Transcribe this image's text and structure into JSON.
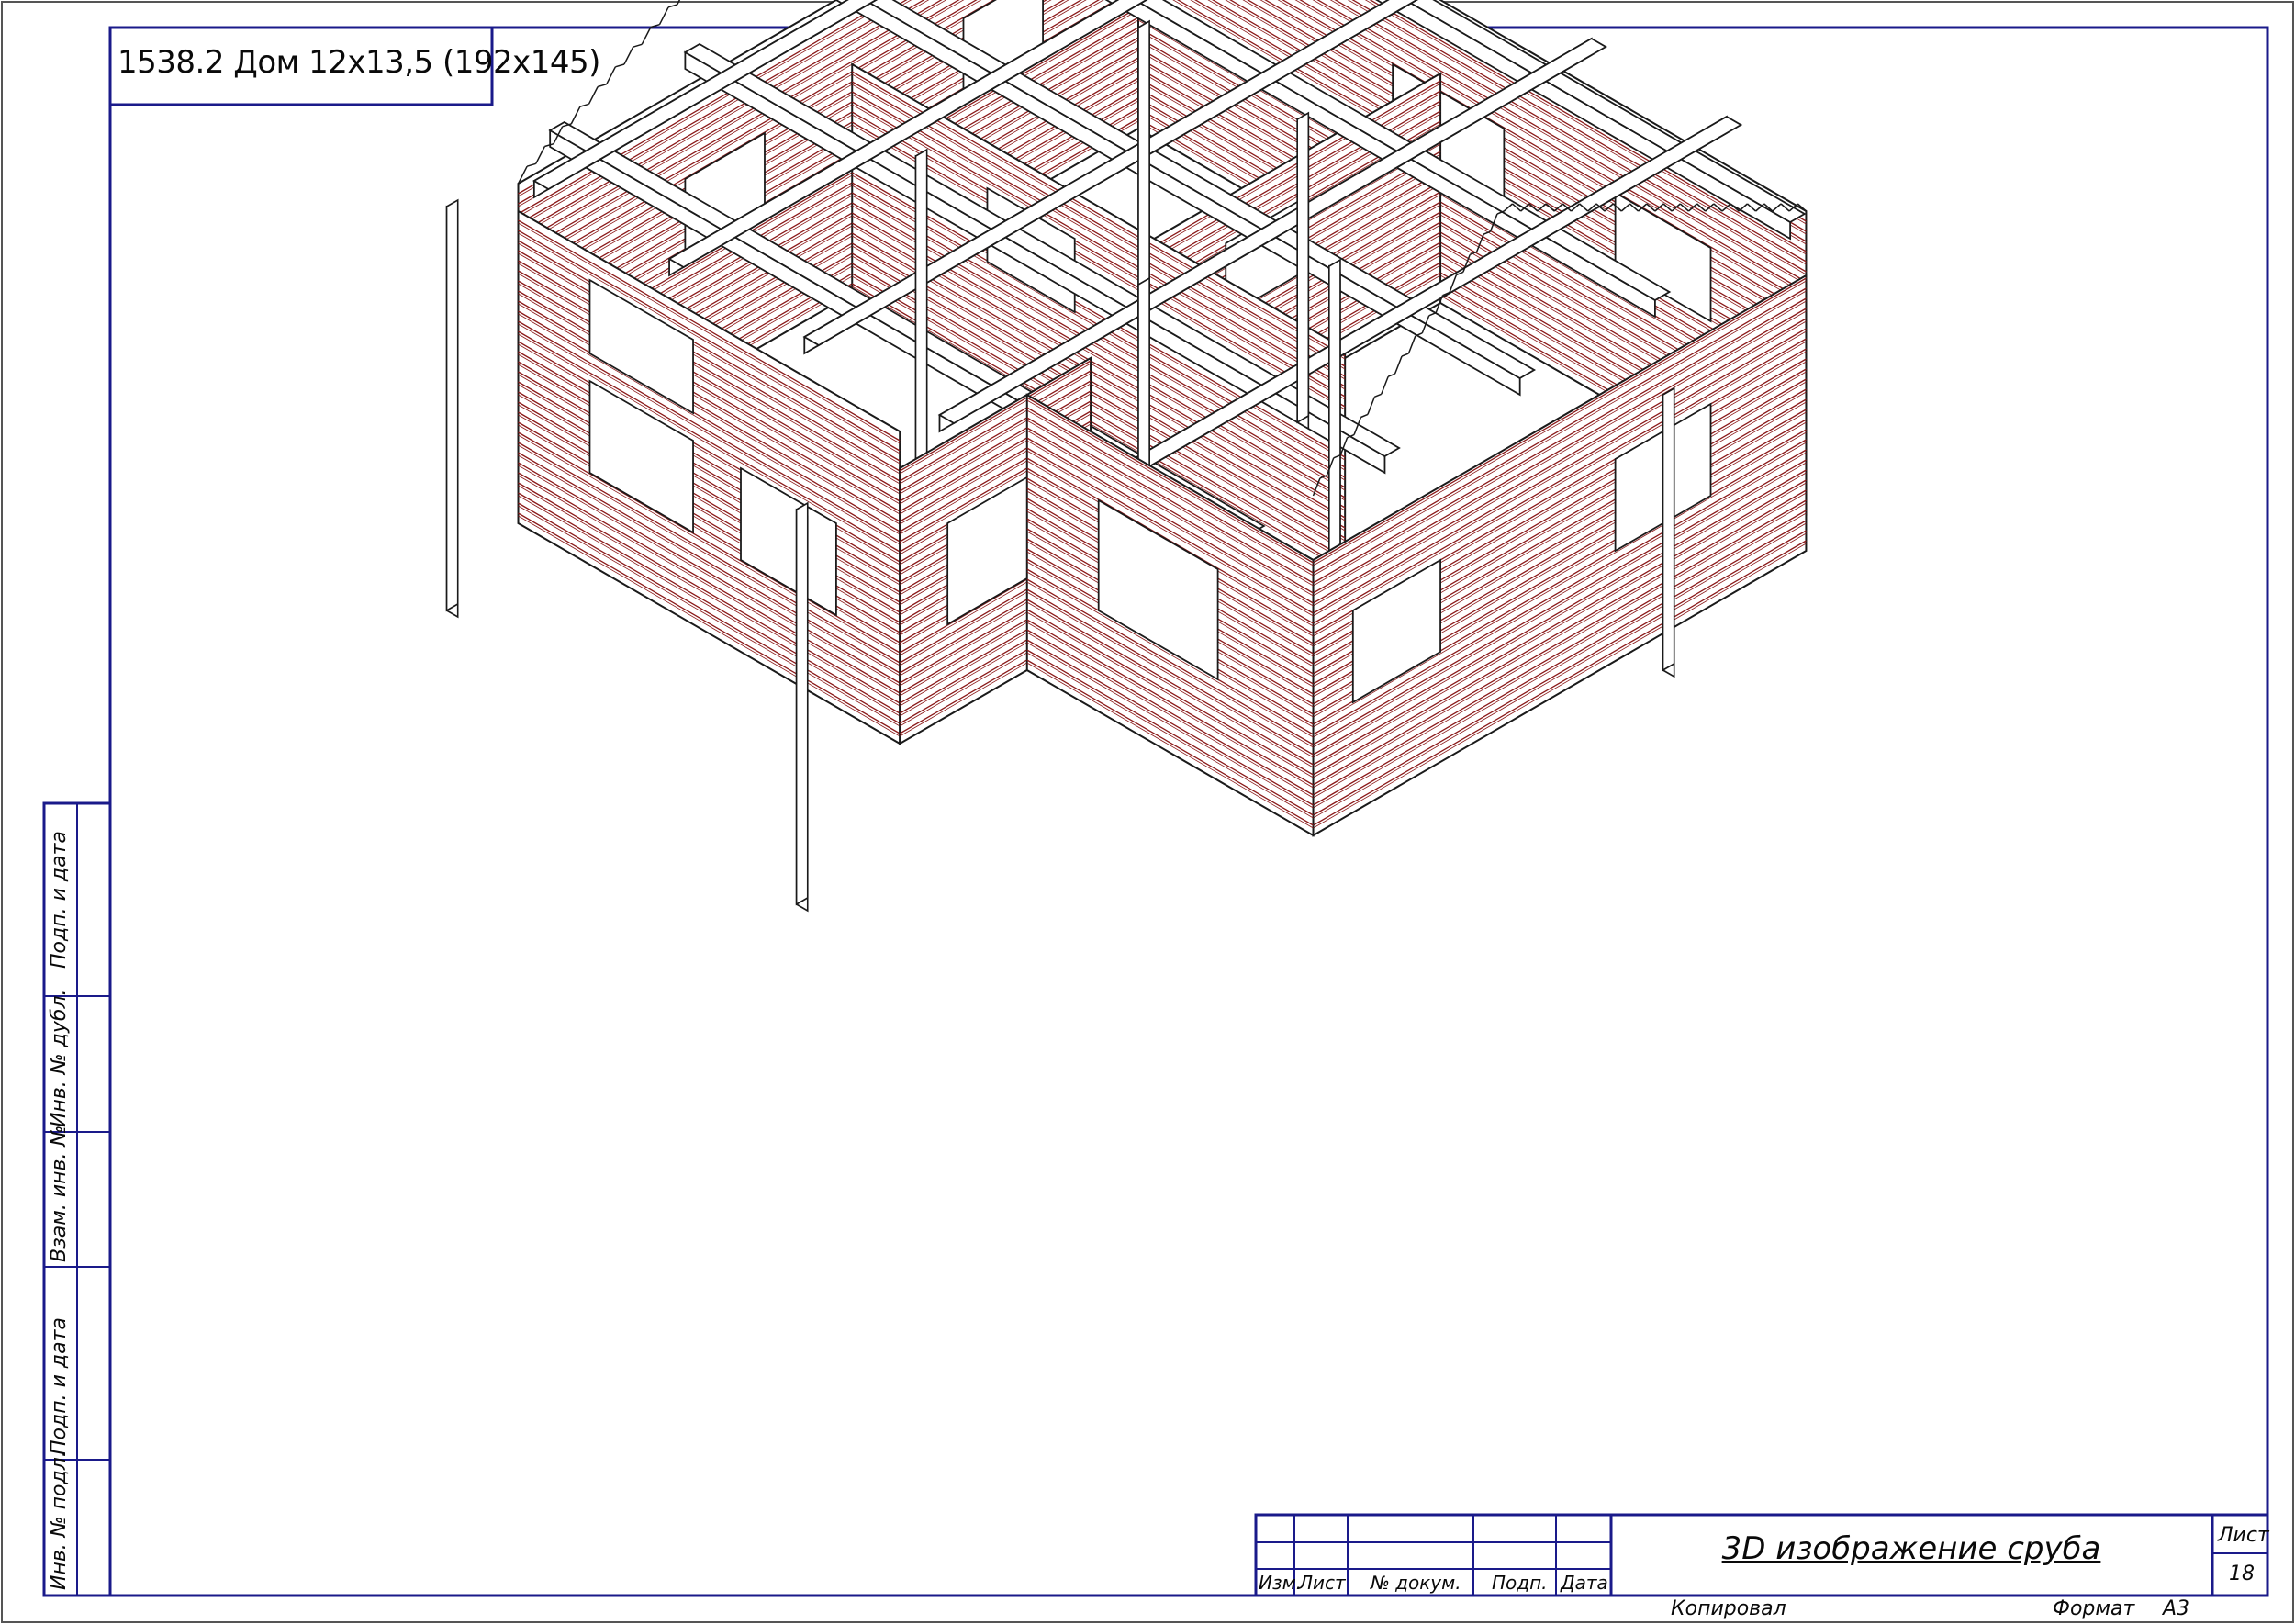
{
  "drawing": {
    "project_code": "1538.2 Дом 12х13,5 (192х145)",
    "title": "3D изображение сруба",
    "sheet_label": "Лист",
    "sheet_number": "18",
    "copied_label": "Копировал",
    "format_label": "Формат",
    "format_value": "A3"
  },
  "title_block_headers": [
    "Изм.",
    "Лист",
    "№ докум.",
    "Подп.",
    "Дата"
  ],
  "side_stamp": [
    "Подп. и дата",
    "Инв. № дубл.",
    "Взам. инв. №",
    "Подп. и дата",
    "Инв. № подл."
  ],
  "colors": {
    "frame": "#1a1a8a",
    "outline": "#1a1a1a",
    "log_lines": "#8b1a1a"
  }
}
